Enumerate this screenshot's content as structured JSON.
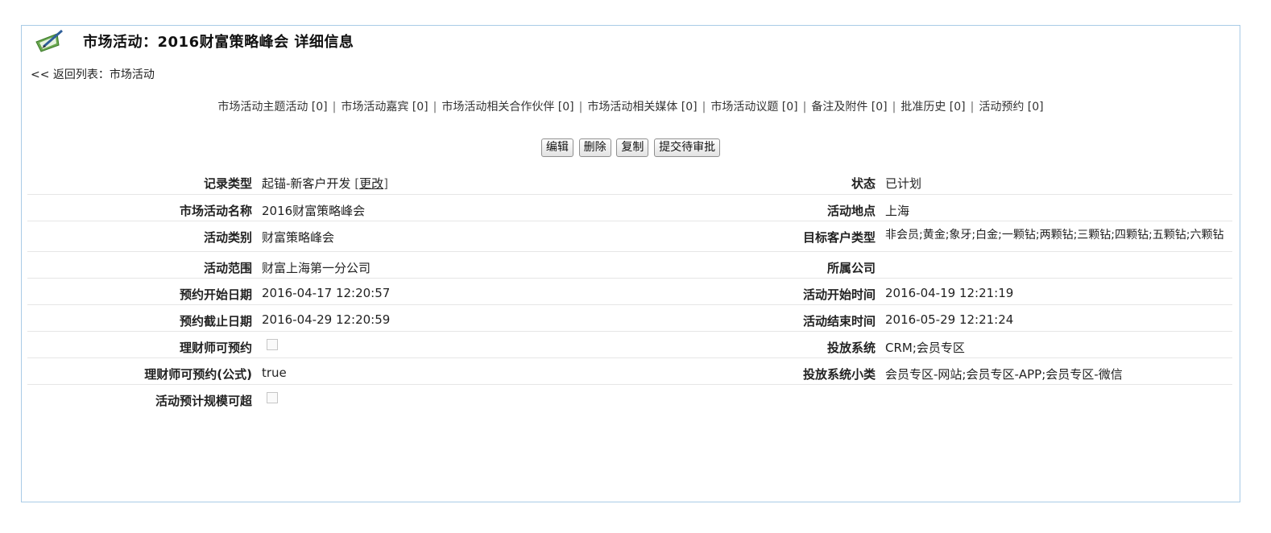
{
  "header": {
    "title": "市场活动：2016财富策略峰会 详细信息",
    "back_link": "<< 返回列表：市场活动"
  },
  "related_links": [
    "市场活动主题活动 [0]",
    "市场活动嘉宾 [0]",
    "市场活动相关合作伙伴 [0]",
    "市场活动相关媒体 [0]",
    "市场活动议题 [0]",
    "备注及附件 [0]",
    "批准历史 [0]",
    "活动预约 [0]"
  ],
  "buttons": {
    "edit": "编辑",
    "delete": "删除",
    "copy": "复制",
    "submit": "提交待审批"
  },
  "fields": {
    "record_type": {
      "label": "记录类型",
      "value": "起锚-新客户开发",
      "change": "更改"
    },
    "status": {
      "label": "状态",
      "value": "已计划"
    },
    "activity_name": {
      "label": "市场活动名称",
      "value": "2016财富策略峰会"
    },
    "location": {
      "label": "活动地点",
      "value": "上海"
    },
    "category": {
      "label": "活动类别",
      "value": "财富策略峰会"
    },
    "target_customer": {
      "label": "目标客户类型",
      "value": "非会员;黄金;象牙;白金;一颗钻;两颗钻;三颗钻;四颗钻;五颗钻;六颗钻"
    },
    "scope": {
      "label": "活动范围",
      "value": "财富上海第一分公司"
    },
    "company": {
      "label": "所属公司",
      "value": ""
    },
    "reserve_start": {
      "label": "预约开始日期",
      "value": "2016-04-17 12:20:57"
    },
    "activity_start": {
      "label": "活动开始时间",
      "value": "2016-04-19 12:21:19"
    },
    "reserve_end": {
      "label": "预约截止日期",
      "value": "2016-04-29 12:20:59"
    },
    "activity_end": {
      "label": "活动结束时间",
      "value": "2016-05-29 12:21:24"
    },
    "advisor_reservable": {
      "label": "理财师可预约",
      "checked": false
    },
    "delivery_system": {
      "label": "投放系统",
      "value": "CRM;会员专区"
    },
    "advisor_reservable_formula": {
      "label": "理财师可预约(公式)",
      "value": "true"
    },
    "delivery_subcategory": {
      "label": "投放系统小类",
      "value": "会员专区-网站;会员专区-APP;会员专区-微信"
    },
    "scale_exceedable": {
      "label": "活动预计规模可超",
      "checked": false
    }
  },
  "colors": {
    "panel_border": "#a9cbe6"
  },
  "icons": {
    "title_icon": "pencil-note-icon"
  }
}
